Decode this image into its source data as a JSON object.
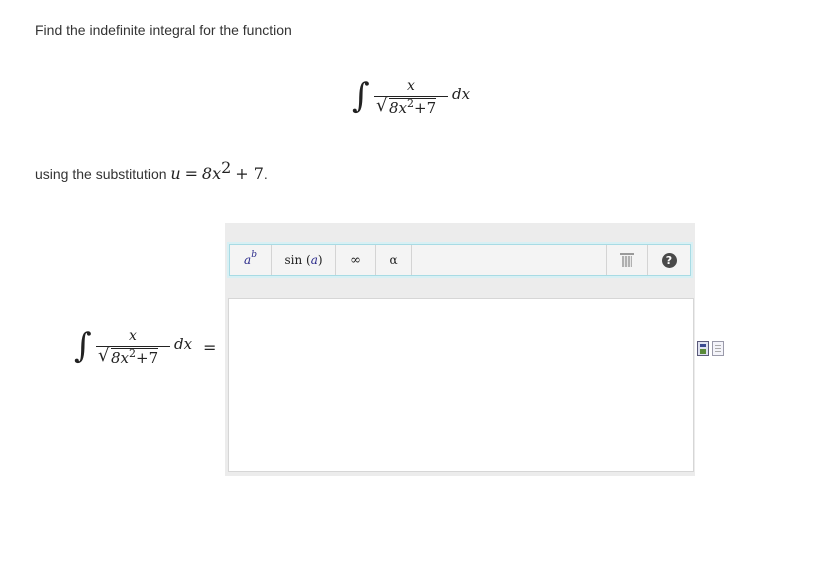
{
  "question": {
    "prompt": "Find the indefinite integral for the function",
    "substitution_text": "using the substitution",
    "substitution_var": "u",
    "substitution_eq": "=",
    "substitution_expr_base": "8x",
    "substitution_expr_exp": "2",
    "substitution_expr_tail": "+ 7",
    "substitution_end": "."
  },
  "integral": {
    "sign": "∫",
    "numerator": "x",
    "radical": "√",
    "denominator_base": "8x",
    "denominator_exp": "2",
    "denominator_tail": "+7",
    "differential": "dx"
  },
  "answer": {
    "equals": "="
  },
  "toolbar": {
    "power_base": "a",
    "power_exp": "b",
    "sin_label": "sin",
    "sin_arg": "a",
    "infinity_label": "∞",
    "alpha_label": "α",
    "help_label": "?"
  },
  "icons": {
    "trash": "trash-icon",
    "help": "help-icon",
    "side_a": "equation-image-icon",
    "side_b": "document-icon"
  }
}
